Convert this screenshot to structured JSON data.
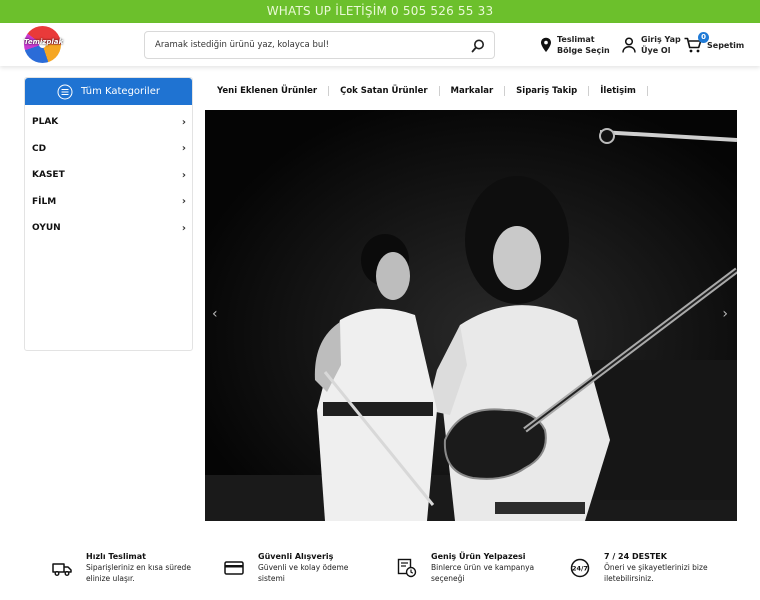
{
  "topbar": {
    "text": "WHATS UP İLETİŞİM 0 505 526 55 33"
  },
  "header": {
    "logo_text": "Temizplak",
    "search": {
      "placeholder": "Aramak istediğin ürünü yaz, kolayca bul!"
    },
    "delivery": {
      "line1": "Teslimat",
      "line2": "Bölge Seçin"
    },
    "account": {
      "line1": "Giriş Yap",
      "line2": "Üye Ol"
    },
    "cart": {
      "label": "Sepetim",
      "count": "0"
    }
  },
  "sidebar": {
    "title": "Tüm Kategoriler",
    "items": [
      {
        "label": "PLAK"
      },
      {
        "label": "CD"
      },
      {
        "label": "KASET"
      },
      {
        "label": "FİLM"
      },
      {
        "label": "OYUN"
      }
    ]
  },
  "nav": {
    "items": [
      {
        "label": "Yeni Eklenen Ürünler"
      },
      {
        "label": "Çok Satan Ürünler"
      },
      {
        "label": "Markalar"
      },
      {
        "label": "Sipariş Takip"
      },
      {
        "label": "İletişim"
      }
    ]
  },
  "hero": {
    "prev": "‹",
    "next": "›"
  },
  "features": [
    {
      "icon": "truck-icon",
      "title": "Hızlı Teslimat",
      "desc": [
        "Siparişleriniz en kısa sürede",
        "elinize ulaşır."
      ]
    },
    {
      "icon": "card-icon",
      "title": "Güvenli Alışveriş",
      "desc": [
        "Güvenli ve kolay ödeme",
        "sistemi"
      ]
    },
    {
      "icon": "box-clock-icon",
      "title": "Geniş Ürün Yelpazesi",
      "desc": [
        "Binlerce ürün ve kampanya",
        "seçeneği"
      ]
    },
    {
      "icon": "support-24-icon",
      "title": "7 / 24 DESTEK",
      "desc": [
        "Öneri ve şikayetlerinizi bize",
        "iletebilirsiniz."
      ]
    }
  ],
  "colors": {
    "topbar": "#6cc02c",
    "accent": "#1f73d2",
    "cart_badge": "#1f7ad6"
  }
}
